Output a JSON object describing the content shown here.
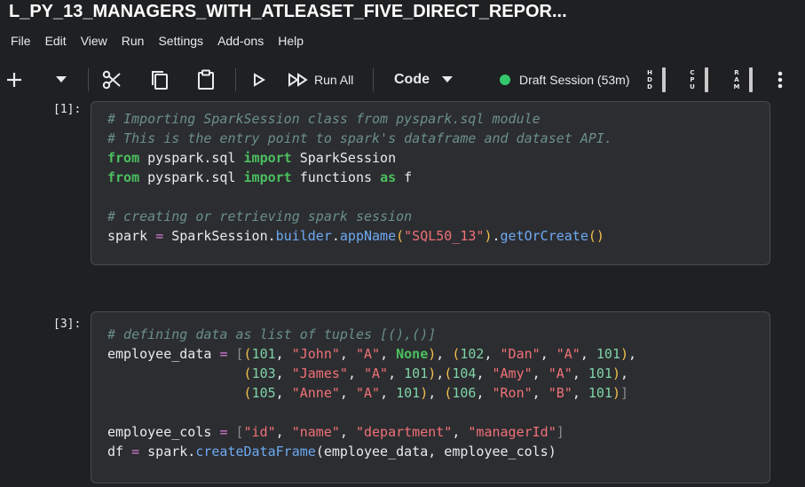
{
  "title": "L_PY_13_MANAGERS_WITH_ATLEASET_FIVE_DIRECT_REPOR...",
  "menu": [
    "File",
    "Edit",
    "View",
    "Run",
    "Settings",
    "Add-ons",
    "Help"
  ],
  "toolbar": {
    "run_all_label": "Run All",
    "cell_type": "Code",
    "session_label": "Draft Session (53m)",
    "meters": [
      {
        "label": "HDD",
        "level": 1.0
      },
      {
        "label": "CPU",
        "level": 1.0
      },
      {
        "label": "RAM",
        "level": 1.0
      }
    ]
  },
  "cells": [
    {
      "prompt": "[1]:",
      "lines": [
        [
          {
            "t": "# Importing SparkSession class from pyspark.sql module",
            "c": "cm"
          }
        ],
        [
          {
            "t": "# This is the entry point to spark's dataframe and dataset API.",
            "c": "cm"
          }
        ],
        [
          {
            "t": "from",
            "c": "kw"
          },
          {
            "t": " pyspark.sql ",
            "c": ""
          },
          {
            "t": "import",
            "c": "kw"
          },
          {
            "t": " SparkSession",
            "c": ""
          }
        ],
        [
          {
            "t": "from",
            "c": "kw"
          },
          {
            "t": " pyspark.sql ",
            "c": ""
          },
          {
            "t": "import",
            "c": "kw"
          },
          {
            "t": " functions ",
            "c": ""
          },
          {
            "t": "as",
            "c": "kw"
          },
          {
            "t": " f",
            "c": ""
          }
        ],
        [],
        [
          {
            "t": "# creating or retrieving spark session",
            "c": "cm"
          }
        ],
        [
          {
            "t": "spark ",
            "c": ""
          },
          {
            "t": "=",
            "c": "op"
          },
          {
            "t": " SparkSession.",
            "c": ""
          },
          {
            "t": "builder",
            "c": "fn"
          },
          {
            "t": ".",
            "c": ""
          },
          {
            "t": "appName",
            "c": "fn"
          },
          {
            "t": "(",
            "c": "brs"
          },
          {
            "t": "\"SQL50_13\"",
            "c": "str"
          },
          {
            "t": ")",
            "c": "brs"
          },
          {
            "t": ".",
            "c": ""
          },
          {
            "t": "getOrCreate",
            "c": "fn"
          },
          {
            "t": "()",
            "c": "brs"
          }
        ]
      ]
    },
    {
      "prompt": "[3]:",
      "lines": [
        [
          {
            "t": "# defining data as list of tuples [(),()]",
            "c": "cm"
          }
        ],
        [
          {
            "t": "employee_data ",
            "c": ""
          },
          {
            "t": "=",
            "c": "op"
          },
          {
            "t": " ",
            "c": ""
          },
          {
            "t": "[",
            "c": "br"
          },
          {
            "t": "(",
            "c": "brs"
          },
          {
            "t": "101",
            "c": "num"
          },
          {
            "t": ", ",
            "c": ""
          },
          {
            "t": "\"John\"",
            "c": "str"
          },
          {
            "t": ", ",
            "c": ""
          },
          {
            "t": "\"A\"",
            "c": "str"
          },
          {
            "t": ", ",
            "c": ""
          },
          {
            "t": "None",
            "c": "none"
          },
          {
            "t": ")",
            "c": "brs"
          },
          {
            "t": ", ",
            "c": ""
          },
          {
            "t": "(",
            "c": "brs"
          },
          {
            "t": "102",
            "c": "num"
          },
          {
            "t": ", ",
            "c": ""
          },
          {
            "t": "\"Dan\"",
            "c": "str"
          },
          {
            "t": ", ",
            "c": ""
          },
          {
            "t": "\"A\"",
            "c": "str"
          },
          {
            "t": ", ",
            "c": ""
          },
          {
            "t": "101",
            "c": "num"
          },
          {
            "t": ")",
            "c": "brs"
          },
          {
            "t": ",",
            "c": ""
          }
        ],
        [
          {
            "t": "                 ",
            "c": ""
          },
          {
            "t": "(",
            "c": "brs"
          },
          {
            "t": "103",
            "c": "num"
          },
          {
            "t": ", ",
            "c": ""
          },
          {
            "t": "\"James\"",
            "c": "str"
          },
          {
            "t": ", ",
            "c": ""
          },
          {
            "t": "\"A\"",
            "c": "str"
          },
          {
            "t": ", ",
            "c": ""
          },
          {
            "t": "101",
            "c": "num"
          },
          {
            "t": ")",
            "c": "brs"
          },
          {
            "t": ",",
            "c": ""
          },
          {
            "t": "(",
            "c": "brs"
          },
          {
            "t": "104",
            "c": "num"
          },
          {
            "t": ", ",
            "c": ""
          },
          {
            "t": "\"Amy\"",
            "c": "str"
          },
          {
            "t": ", ",
            "c": ""
          },
          {
            "t": "\"A\"",
            "c": "str"
          },
          {
            "t": ", ",
            "c": ""
          },
          {
            "t": "101",
            "c": "num"
          },
          {
            "t": ")",
            "c": "brs"
          },
          {
            "t": ",",
            "c": ""
          }
        ],
        [
          {
            "t": "                 ",
            "c": ""
          },
          {
            "t": "(",
            "c": "brs"
          },
          {
            "t": "105",
            "c": "num"
          },
          {
            "t": ", ",
            "c": ""
          },
          {
            "t": "\"Anne\"",
            "c": "str"
          },
          {
            "t": ", ",
            "c": ""
          },
          {
            "t": "\"A\"",
            "c": "str"
          },
          {
            "t": ", ",
            "c": ""
          },
          {
            "t": "101",
            "c": "num"
          },
          {
            "t": ")",
            "c": "brs"
          },
          {
            "t": ", ",
            "c": ""
          },
          {
            "t": "(",
            "c": "brs"
          },
          {
            "t": "106",
            "c": "num"
          },
          {
            "t": ", ",
            "c": ""
          },
          {
            "t": "\"Ron\"",
            "c": "str"
          },
          {
            "t": ", ",
            "c": ""
          },
          {
            "t": "\"B\"",
            "c": "str"
          },
          {
            "t": ", ",
            "c": ""
          },
          {
            "t": "101",
            "c": "num"
          },
          {
            "t": ")",
            "c": "brs"
          },
          {
            "t": "]",
            "c": "br"
          }
        ],
        [],
        [
          {
            "t": "employee_cols ",
            "c": ""
          },
          {
            "t": "=",
            "c": "op"
          },
          {
            "t": " ",
            "c": ""
          },
          {
            "t": "[",
            "c": "br"
          },
          {
            "t": "\"id\"",
            "c": "str"
          },
          {
            "t": ", ",
            "c": ""
          },
          {
            "t": "\"name\"",
            "c": "str"
          },
          {
            "t": ", ",
            "c": ""
          },
          {
            "t": "\"department\"",
            "c": "str"
          },
          {
            "t": ", ",
            "c": ""
          },
          {
            "t": "\"managerId\"",
            "c": "str"
          },
          {
            "t": "]",
            "c": "br"
          }
        ],
        [
          {
            "t": "df ",
            "c": ""
          },
          {
            "t": "=",
            "c": "op"
          },
          {
            "t": " spark.",
            "c": ""
          },
          {
            "t": "createDataFrame",
            "c": "fn"
          },
          {
            "t": "(employee_data, employee_cols)",
            "c": ""
          }
        ]
      ]
    }
  ]
}
